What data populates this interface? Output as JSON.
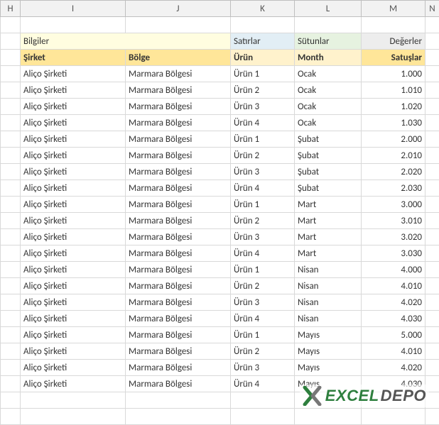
{
  "columnHeaders": {
    "H": "H",
    "I": "I",
    "J": "J",
    "K": "K",
    "L": "L",
    "M": "M",
    "N": "N"
  },
  "sectionLabels": {
    "bilgiler": "Bilgiler",
    "satirlar": "Satırlar",
    "sutunlar": "Sütunlar",
    "degerler": "Değerler"
  },
  "headers": {
    "sirket": "Şirket",
    "bolge": "Bölge",
    "urun": "Ürün",
    "month": "Month",
    "satuslar": "Satuşlar"
  },
  "rows": [
    {
      "sirket": "Aliço Şirketi",
      "bolge": "Marmara Bölgesi",
      "urun": "Ürün 1",
      "month": "Ocak",
      "satuslar": "1.000"
    },
    {
      "sirket": "Aliço Şirketi",
      "bolge": "Marmara Bölgesi",
      "urun": "Ürün 2",
      "month": "Ocak",
      "satuslar": "1.010"
    },
    {
      "sirket": "Aliço Şirketi",
      "bolge": "Marmara Bölgesi",
      "urun": "Ürün 3",
      "month": "Ocak",
      "satuslar": "1.020"
    },
    {
      "sirket": "Aliço Şirketi",
      "bolge": "Marmara Bölgesi",
      "urun": "Ürün 4",
      "month": "Ocak",
      "satuslar": "1.030"
    },
    {
      "sirket": "Aliço Şirketi",
      "bolge": "Marmara Bölgesi",
      "urun": "Ürün 1",
      "month": "Şubat",
      "satuslar": "2.000"
    },
    {
      "sirket": "Aliço Şirketi",
      "bolge": "Marmara Bölgesi",
      "urun": "Ürün 2",
      "month": "Şubat",
      "satuslar": "2.010"
    },
    {
      "sirket": "Aliço Şirketi",
      "bolge": "Marmara Bölgesi",
      "urun": "Ürün 3",
      "month": "Şubat",
      "satuslar": "2.020"
    },
    {
      "sirket": "Aliço Şirketi",
      "bolge": "Marmara Bölgesi",
      "urun": "Ürün 4",
      "month": "Şubat",
      "satuslar": "2.030"
    },
    {
      "sirket": "Aliço Şirketi",
      "bolge": "Marmara Bölgesi",
      "urun": "Ürün 1",
      "month": "Mart",
      "satuslar": "3.000"
    },
    {
      "sirket": "Aliço Şirketi",
      "bolge": "Marmara Bölgesi",
      "urun": "Ürün 2",
      "month": "Mart",
      "satuslar": "3.010"
    },
    {
      "sirket": "Aliço Şirketi",
      "bolge": "Marmara Bölgesi",
      "urun": "Ürün 3",
      "month": "Mart",
      "satuslar": "3.020"
    },
    {
      "sirket": "Aliço Şirketi",
      "bolge": "Marmara Bölgesi",
      "urun": "Ürün 4",
      "month": "Mart",
      "satuslar": "3.030"
    },
    {
      "sirket": "Aliço Şirketi",
      "bolge": "Marmara Bölgesi",
      "urun": "Ürün 1",
      "month": "Nisan",
      "satuslar": "4.000"
    },
    {
      "sirket": "Aliço Şirketi",
      "bolge": "Marmara Bölgesi",
      "urun": "Ürün 2",
      "month": "Nisan",
      "satuslar": "4.010"
    },
    {
      "sirket": "Aliço Şirketi",
      "bolge": "Marmara Bölgesi",
      "urun": "Ürün 3",
      "month": "Nisan",
      "satuslar": "4.020"
    },
    {
      "sirket": "Aliço Şirketi",
      "bolge": "Marmara Bölgesi",
      "urun": "Ürün 4",
      "month": "Nisan",
      "satuslar": "4.030"
    },
    {
      "sirket": "Aliço Şirketi",
      "bolge": "Marmara Bölgesi",
      "urun": "Ürün 1",
      "month": "Mayıs",
      "satuslar": "5.000"
    },
    {
      "sirket": "Aliço Şirketi",
      "bolge": "Marmara Bölgesi",
      "urun": "Ürün 2",
      "month": "Mayıs",
      "satuslar": "4.010"
    },
    {
      "sirket": "Aliço Şirketi",
      "bolge": "Marmara Bölgesi",
      "urun": "Ürün 3",
      "month": "Mayıs",
      "satuslar": "4.020"
    },
    {
      "sirket": "Aliço Şirketi",
      "bolge": "Marmara Bölgesi",
      "urun": "Ürün 4",
      "month": "Mayıs",
      "satuslar": "4.030"
    }
  ],
  "logo": {
    "part1": "EXCEL",
    "part2": "DEPO"
  }
}
